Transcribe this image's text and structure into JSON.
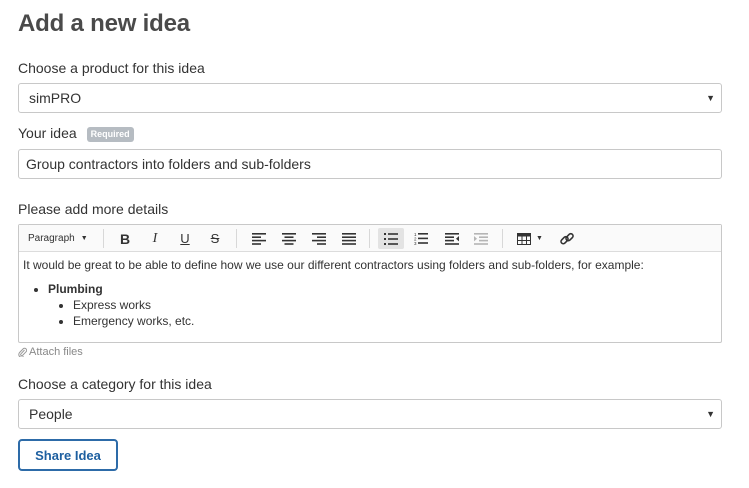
{
  "page": {
    "title": "Add a new idea"
  },
  "product": {
    "label": "Choose a product for this idea",
    "selected": "simPRO"
  },
  "idea": {
    "label": "Your idea",
    "required_badge": "Required",
    "value": "Group contractors into folders and sub-folders"
  },
  "details": {
    "label": "Please add more details",
    "toolbar": {
      "format_label": "Paragraph",
      "buttons": [
        "bold-icon",
        "italic-icon",
        "underline-icon",
        "strikethrough-icon",
        "align-left-icon",
        "align-center-icon",
        "align-right-icon",
        "align-justify-icon",
        "bullet-list-icon",
        "numbered-list-icon",
        "outdent-icon",
        "indent-icon",
        "table-icon",
        "link-icon"
      ]
    },
    "body": {
      "intro": "It would be great to be able to define how we use our different contractors using folders and sub-folders, for example:",
      "list_title": "Plumbing",
      "sub_items": [
        "Express works",
        "Emergency works, etc."
      ]
    },
    "attach_label": "Attach files"
  },
  "category": {
    "label": "Choose a category for this idea",
    "selected": "People"
  },
  "share_button": "Share Idea"
}
